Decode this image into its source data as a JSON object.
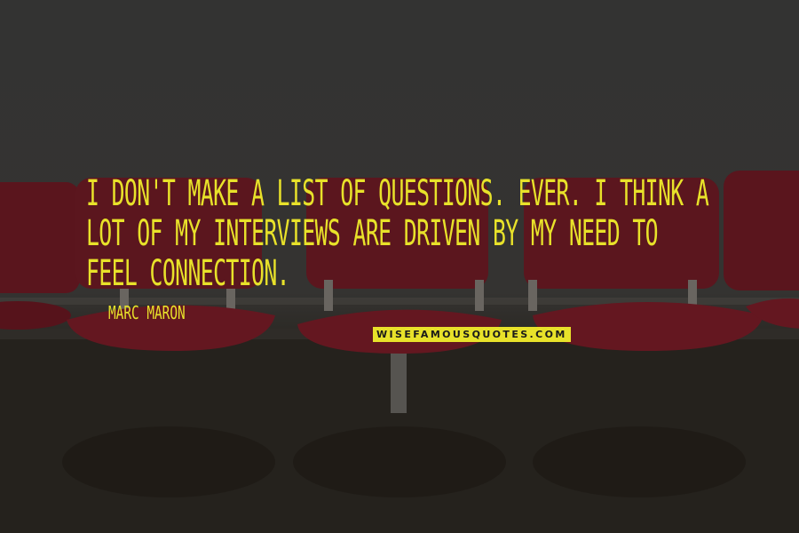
{
  "quote": {
    "lines": [
      "I DON'T MAKE A LIST OF QUESTIONS. EVER. I THINK A",
      "LOT OF MY INTERVIEWS ARE DRIVEN BY MY NEED TO",
      "FEEL CONNECTION."
    ],
    "author": "MARC MARON"
  },
  "watermark": "WISEFAMOUSQUOTES.COM",
  "colors": {
    "text": "#e8e22a",
    "wall": "#3f3f3d",
    "chair": "#6e1a24"
  }
}
